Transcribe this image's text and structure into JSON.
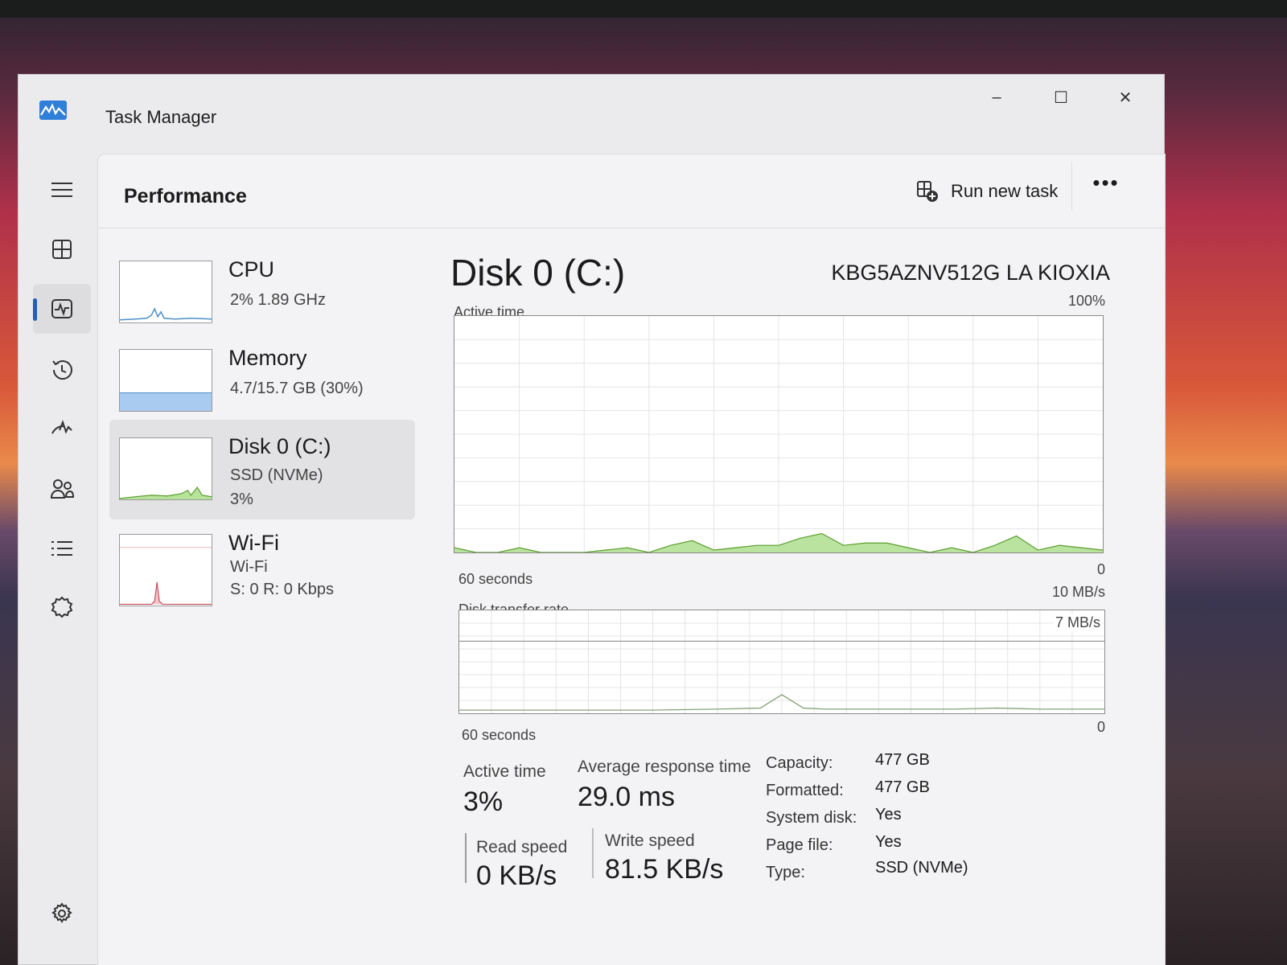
{
  "window": {
    "title": "Task Manager",
    "minimize_glyph": "–",
    "maximize_glyph": "☐",
    "close_glyph": "✕"
  },
  "nav": {
    "items": [
      {
        "icon": "hamburger-menu-icon"
      },
      {
        "icon": "processes-icon"
      },
      {
        "icon": "performance-icon",
        "active": true
      },
      {
        "icon": "app-history-icon"
      },
      {
        "icon": "startup-apps-icon"
      },
      {
        "icon": "users-icon"
      },
      {
        "icon": "details-icon"
      },
      {
        "icon": "services-icon"
      },
      {
        "icon": "settings-icon"
      }
    ]
  },
  "commandbar": {
    "page_title": "Performance",
    "run_new_task_label": "Run new task",
    "more_glyph": "•••"
  },
  "resources": [
    {
      "name": "CPU",
      "line1": "2%  1.89 GHz",
      "line2": "",
      "line3": ""
    },
    {
      "name": "Memory",
      "line1": "4.7/15.7 GB (30%)",
      "line2": "",
      "line3": ""
    },
    {
      "name": "Disk 0 (C:)",
      "line1": "SSD (NVMe)",
      "line2": "3%",
      "line3": "",
      "selected": true
    },
    {
      "name": "Wi-Fi",
      "line1": "Wi-Fi",
      "line2": "S: 0 R: 0 Kbps",
      "line3": ""
    }
  ],
  "detail": {
    "title": "Disk 0 (C:)",
    "model": "KBG5AZNV512G LA KIOXIA",
    "active_time_graph": {
      "label": "Active time",
      "max_label": "100%",
      "min_label": "0",
      "time_label": "60 seconds"
    },
    "transfer_graph": {
      "label": "Disk transfer rate",
      "max_label": "10 MB/s",
      "mid_label": "7 MB/s",
      "min_label": "0",
      "time_label": "60 seconds"
    },
    "stats": {
      "active_time_label": "Active time",
      "active_time_value": "3%",
      "avg_response_label": "Average response time",
      "avg_response_value": "29.0 ms",
      "read_speed_label": "Read speed",
      "read_speed_value": "0 KB/s",
      "write_speed_label": "Write speed",
      "write_speed_value": "81.5 KB/s"
    },
    "properties": [
      {
        "key": "Capacity:",
        "value": "477 GB"
      },
      {
        "key": "Formatted:",
        "value": "477 GB"
      },
      {
        "key": "System disk:",
        "value": "Yes"
      },
      {
        "key": "Page file:",
        "value": "Yes"
      },
      {
        "key": "Type:",
        "value": "SSD (NVMe)"
      }
    ]
  },
  "colors": {
    "accent": "#1f5fbf",
    "disk_green_fill": "#b6e29a",
    "disk_green_line": "#5a9e2e",
    "cpu_blue": "#4d8fc7",
    "memory_blue": "#a9cbef",
    "wifi_red": "#c84d5a"
  },
  "chart_data": [
    {
      "type": "area",
      "title": "Active time",
      "ylim": [
        0,
        100
      ],
      "x": [
        0,
        2,
        4,
        6,
        8,
        10,
        12,
        14,
        16,
        18,
        20,
        22,
        24,
        26,
        28,
        30,
        32,
        34,
        36,
        38,
        40,
        42,
        44,
        46,
        48,
        50,
        52,
        54,
        56,
        58,
        60
      ],
      "values": [
        2,
        0,
        0,
        2,
        0,
        0,
        0,
        1,
        2,
        0,
        3,
        5,
        1,
        2,
        3,
        3,
        6,
        8,
        3,
        4,
        4,
        2,
        0,
        2,
        0,
        3,
        7,
        1,
        3,
        2,
        1
      ]
    },
    {
      "type": "line",
      "title": "Disk transfer rate",
      "ylim": [
        0,
        10
      ],
      "x": [
        0,
        6,
        12,
        18,
        24,
        28,
        30,
        32,
        34,
        36,
        40,
        46,
        50,
        54,
        60
      ],
      "values": [
        0,
        0,
        0,
        0,
        0.1,
        0.2,
        1.5,
        0.2,
        0.1,
        0.1,
        0.1,
        0.1,
        0.2,
        0.1,
        0.1
      ]
    }
  ]
}
